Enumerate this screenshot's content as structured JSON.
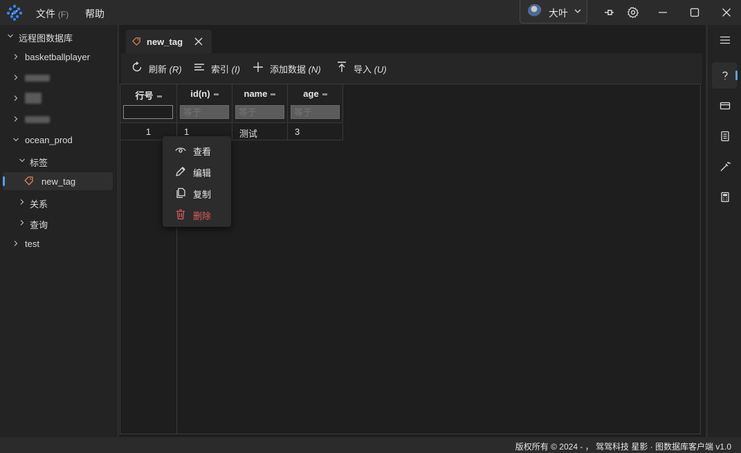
{
  "menu": {
    "file_label": "文件",
    "file_hotkey": "(F)",
    "help_label": "帮助"
  },
  "user": {
    "name": "大叶"
  },
  "sidebar": {
    "root": "远程图数据库",
    "items": [
      {
        "label": "basketballplayer"
      },
      {
        "label": "ocean_prod"
      },
      {
        "label": "标签"
      },
      {
        "label": "new_tag"
      },
      {
        "label": "关系"
      },
      {
        "label": "查询"
      },
      {
        "label": "test"
      }
    ]
  },
  "tab": {
    "label": "new_tag"
  },
  "toolbar": {
    "refresh": {
      "label": "刷新",
      "hotkey": "(R)"
    },
    "index": {
      "label": "索引",
      "hotkey": "(I)"
    },
    "add": {
      "label": "添加数据",
      "hotkey": "(N)"
    },
    "import": {
      "label": "导入",
      "hotkey": "(U)"
    }
  },
  "grid": {
    "columns": [
      "行号",
      "id(n)",
      "name",
      "age"
    ],
    "filter_placeholder": "等于",
    "rows": [
      [
        "1",
        "1",
        "测试",
        "3"
      ]
    ]
  },
  "context_menu": {
    "view": "查看",
    "edit": "编辑",
    "copy": "复制",
    "delete": "删除"
  },
  "status": {
    "text": "版权所有 © 2024 - ， 驾驾科技  星影 · 图数据库客户端  v1.0"
  },
  "colors": {
    "accent": "#5aa0e6",
    "danger": "#e05a5a",
    "tag_icon": "#e0845a"
  }
}
